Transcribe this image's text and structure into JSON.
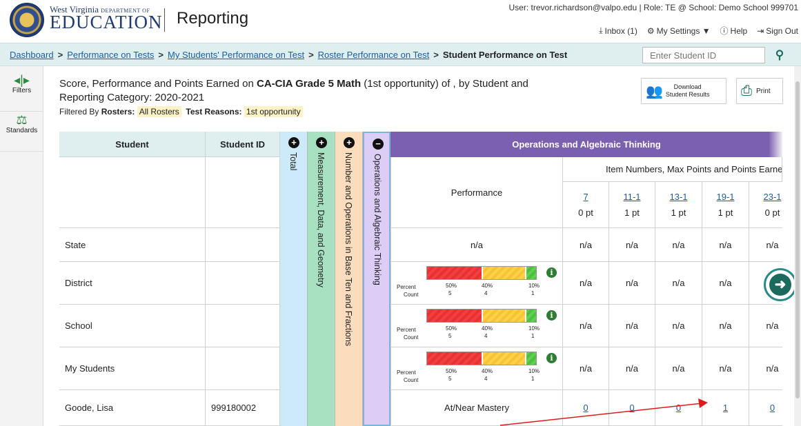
{
  "header": {
    "brand_top": "West Virginia",
    "brand_top_small": "DEPARTMENT OF",
    "brand_main": "EDUCATION",
    "app_title": "Reporting",
    "user_info": "User: trevor.richardson@valpo.edu   |  Role: TE @ School: Demo School 999701",
    "inbox": "Inbox (1)",
    "settings": "My Settings ▼",
    "help": "Help",
    "signout": "Sign Out"
  },
  "breadcrumb": {
    "items": [
      "Dashboard",
      "Performance on Tests",
      "My Students' Performance on Test",
      "Roster Performance on Test"
    ],
    "current": "Student Performance on Test",
    "separator": ">"
  },
  "search": {
    "placeholder": "Enter Student ID"
  },
  "rail": {
    "filters": "Filters",
    "standards": "Standards"
  },
  "report": {
    "title_pre": "Score, Performance and Points Earned on ",
    "test_name": "CA-CIA Grade 5 Math",
    "title_post": " (1st opportunity) of , by Student and Reporting Category: 2020-2021",
    "filtered_by": "Filtered By",
    "rosters_label": "Rosters:",
    "rosters_value": "All Rosters",
    "reasons_label": "Test Reasons:",
    "reasons_value": "1st opportunity"
  },
  "actions": {
    "download_line1": "Download",
    "download_line2": "Student Results",
    "print": "Print"
  },
  "table": {
    "col_student": "Student",
    "col_student_id": "Student ID",
    "toggles": [
      {
        "label": "Total",
        "state": "+",
        "color": "#cdeafa"
      },
      {
        "label": "Measurement, Data, and Geometry",
        "state": "+",
        "color": "#a8e0c2"
      },
      {
        "label": "Number and Operations in Base Ten and Fractions",
        "state": "+",
        "color": "#fbdcbc"
      },
      {
        "label": "Operations and Algebraic Thinking",
        "state": "−",
        "color": "#dccdf7"
      }
    ],
    "oat_header": "Operations and Algebraic Thinking",
    "items_caption": "Item Numbers, Max Points and Points Earned",
    "performance_label": "Performance",
    "items": [
      {
        "num": "7",
        "pts": "0 pt"
      },
      {
        "num": "11-1",
        "pts": "1 pt"
      },
      {
        "num": "13-1",
        "pts": "1 pt"
      },
      {
        "num": "19-1",
        "pts": "1 pt"
      },
      {
        "num": "23-1",
        "pts": "0 pt"
      }
    ],
    "percent_label": "Percent",
    "count_label": "Count",
    "bar": {
      "percents": [
        "50%",
        "40%",
        "10%"
      ],
      "counts": [
        "5",
        "4",
        "1"
      ],
      "fractions": [
        0.5,
        0.4,
        0.1
      ]
    },
    "rows": [
      {
        "name": "State",
        "id": "",
        "performance": "n/a",
        "bar": false,
        "items": [
          "n/a",
          "n/a",
          "n/a",
          "n/a",
          "n/a"
        ]
      },
      {
        "name": "District",
        "id": "",
        "performance": "",
        "bar": true,
        "items": [
          "n/a",
          "n/a",
          "n/a",
          "n/a",
          "n/a"
        ]
      },
      {
        "name": "School",
        "id": "",
        "performance": "",
        "bar": true,
        "items": [
          "n/a",
          "n/a",
          "n/a",
          "n/a",
          "n/a"
        ]
      },
      {
        "name": "My Students",
        "id": "",
        "performance": "",
        "bar": true,
        "items": [
          "n/a",
          "n/a",
          "n/a",
          "n/a",
          "n/a"
        ]
      },
      {
        "name": "Goode, Lisa",
        "id": "999180002",
        "performance": "At/Near Mastery",
        "bar": false,
        "items": [
          "0",
          "0",
          "0",
          "1",
          "0"
        ]
      }
    ]
  }
}
